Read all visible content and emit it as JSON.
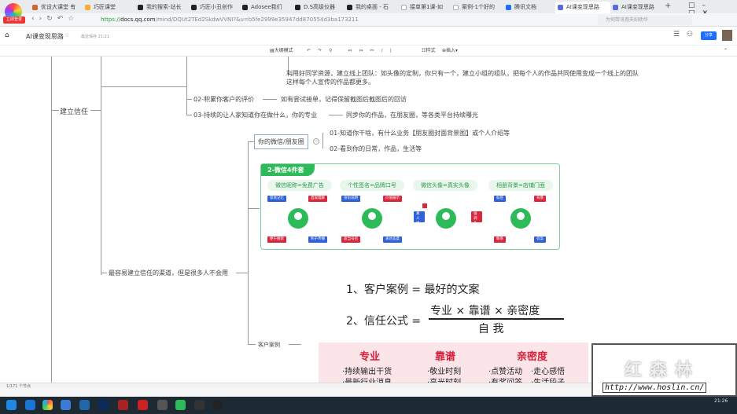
{
  "browser": {
    "login_badge": "立即登录",
    "tabs": [
      {
        "label": "优设大课堂 有"
      },
      {
        "label": "巧匠课堂"
      },
      {
        "label": "我的搜索-站长"
      },
      {
        "label": "巧匠小丑创作"
      },
      {
        "label": "Adosee我们"
      },
      {
        "label": "D.S高级仪器"
      },
      {
        "label": "我的桌面 - 石"
      },
      {
        "label": "接单第1课-如"
      },
      {
        "label": "案例-1个好的"
      },
      {
        "label": "腾讯文档"
      },
      {
        "label": "AI课变现思路",
        "active": true
      },
      {
        "label": "AI课变现思路"
      }
    ],
    "url_scheme": "https://",
    "url_host": "docs.qq.com",
    "url_path": "/mind/DQUt2TEd2SkdwVVNI?&u=b5fe2999e35947dd870554d3ba173211",
    "search_placeholder": "为何带讯孢夫妇劝华"
  },
  "doc": {
    "title": "AI课变现思路",
    "saved": "最近保存 21:21",
    "share_label": "分享"
  },
  "toolbar": {
    "outline": "大纲模式",
    "style": "样式",
    "insert": "插入"
  },
  "mindmap": {
    "root": "建立信任",
    "tip1": "利用好同学资源，建立线上团队：如头像的定制，你只有一个，建立小组的组队，把每个人的作品共同使用变成一个线上的团队",
    "tip1b": "这样每个人宣传的作品都更多。",
    "n02": "02-积累你客户的评价",
    "n02a": "如有尝试接单，记得保留截图后截图后的回访",
    "n03": "03-持续的让人家知道你在做什么，你的专业",
    "n03a": "同步你的作品，在朋友圈，等各类平台持续曝光",
    "channel": "最容易建立信任的渠道，但是很多人不会用",
    "wechat": "你的微信/朋友圈",
    "w01": "01-知道你干啥，有什么业务【朋友圈封面背景图】或个人介绍等",
    "w02": "02-看到你的日常，作品，生活等",
    "cases": "客户案例"
  },
  "infographic": {
    "title": "2-微信4件套",
    "groups": [
      {
        "label": "微信昵称=免费广告",
        "tags": [
          "容易记忆",
          "直观理解",
          "便于搜索",
          "利于传播"
        ]
      },
      {
        "label": "个性签名=品牌口号",
        "tags": [
          "身份说明",
          "价值展示",
          "适当号召",
          "表达态度"
        ]
      },
      {
        "label": "微信头像=真实头像",
        "tags": [
          "真人出镜",
          "强调头像"
        ]
      },
      {
        "label": "相册背景=店铺门面",
        "tags": [
          "标签",
          "背景",
          "联系",
          "答案"
        ]
      }
    ]
  },
  "formula": {
    "line1": "1、客户案例  =  最好的文案",
    "line2_prefix": "2、信任公式  =",
    "numerator": "专业  ×  靠谱  ×  亲密度",
    "denominator": "自    我"
  },
  "pink": {
    "h1": "专业",
    "h2": "靠谱",
    "h3": "亲密度",
    "i1": "·持续输出干货",
    "i2": "·最新行业消息",
    "i3": "·敬业时刻",
    "i4": "·高光时刻",
    "i5": "·点赞活动",
    "i6": "·有奖问答",
    "i7": "·走心感悟",
    "i8": "·生活段子"
  },
  "watermark": {
    "title": "红森林",
    "url": "http://www.hoslin.cn/"
  },
  "status": {
    "text": "1/171 个节点"
  },
  "clock": {
    "time": "21:26"
  }
}
